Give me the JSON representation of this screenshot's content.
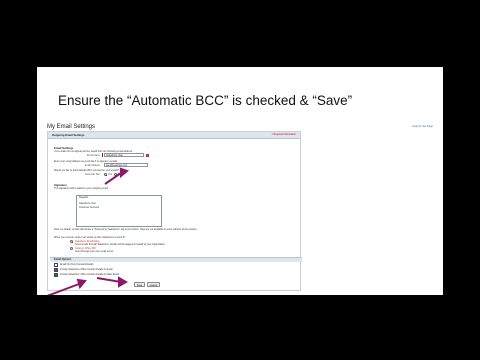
{
  "headline": "Ensure the “Automatic BCC” is checked & “Save”",
  "page": {
    "title": "My Email Settings",
    "help_link": "Help for this Page"
  },
  "panel": {
    "header": "Outgoing Email Settings",
    "required_note": "= Required Information",
    "sections": {
      "general": "Email Settings",
      "signature": "Signature",
      "templates": "Email Options"
    },
    "texts": {
      "name_intro": "Your emails do not appear as they would from the following email address:",
      "address_intro": "Enter your email address as you'd like it to appear in emails",
      "bcc_intro": "Would you like to automatically BCC yourself on your emails?",
      "signature_intro": "This signature will be added to your outgoing email",
      "note_line": "Note: by default, emails will include a \"Powered by Salesforce\" tag at the bottom. Tags are not available in some editions of the product.",
      "note_line2": "Templates",
      "send_through": "When you send an email, how would you like Salesforce to send it?",
      "opt1": "Salesforce Email Relay",
      "opt1_desc": "Send emails through Salesforce. Emails will be tagged on behalf of your organization.",
      "opt2": "Gmail or Office 365",
      "opt2_desc": "Send through your own email server."
    },
    "fields": {
      "name_label": "Email Name",
      "name_value": "Salesforce User",
      "address_label": "Email Address",
      "address_value": "user@example.com",
      "bcc_label": "Automatic Bcc",
      "bcc_yes": "Yes",
      "bcc_no": "No"
    },
    "signature_lines": [
      "Regards,",
      "",
      "Salesforce User",
      "Customer Success"
    ],
    "checkbox_rows": [
      {
        "label": "Email Opt Out (Contact Emails)",
        "checked": false
      },
      {
        "label": "Include Salesforce Office Contact Details in Email",
        "checked": true
      },
      {
        "label": "Include Salesforce Office Contact Details in Mass Email",
        "checked": true
      }
    ],
    "buttons": {
      "save": "Save",
      "cancel": "Cancel"
    }
  },
  "colors": {
    "arrow": "#8b1a6b",
    "slide_bg": "#ffffff",
    "frame_bg": "#000000"
  }
}
